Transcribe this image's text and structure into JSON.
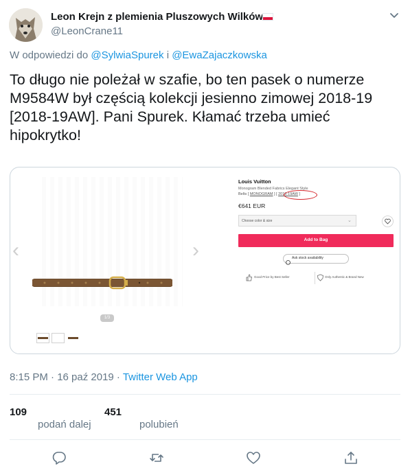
{
  "tweet": {
    "display_name": "Leon Krejn z plemienia Pluszowych Wilków",
    "handle": "@LeonCrane11",
    "reply_prefix": "W odpowiedzi do",
    "reply_to_1": "@SylwiaSpurek",
    "reply_joiner": "i",
    "reply_to_2": "@EwaZajaczkowska",
    "text": "To długo nie poleżał w szafie, bo ten pasek o numerze M9584W był częścią kolekcji jesienno zimowej 2018-19 [2018-19AW]. Pani Spurek. Kłamać trzeba umieć hipokrytko!",
    "timestamp": "8:15 PM · 16 paź 2019 · ",
    "source_app": "Twitter Web App"
  },
  "stats": {
    "retweets_count": "109",
    "retweets_label": "podań dalej",
    "likes_count": "451",
    "likes_label": "polubień"
  },
  "embedded_image": {
    "brand": "Louis Vuitton",
    "product_name": "Monogram Blended Fabrics Elegant Style",
    "cat_1": "Belts",
    "cat_2": "MONOGRAM",
    "cat_3": "2018-19AW",
    "price": "€641 EUR",
    "select_placeholder": "Choose color & size",
    "add_to_bag": "Add to Bag",
    "stock_button": "Ask stock availability",
    "good_price": "Good Price by Best Seller",
    "authentic": "Only Authentic & Brand New",
    "pager": "1/3"
  },
  "colors": {
    "link": "#1b95e0",
    "muted": "#657786",
    "add_to_bag": "#f02b5b",
    "highlight_circle": "#d4262c"
  },
  "icons": [
    "chevron-down-icon",
    "reply-icon",
    "retweet-icon",
    "like-icon",
    "share-icon",
    "heart-icon",
    "chat-bubble-icon",
    "shield-icon"
  ]
}
